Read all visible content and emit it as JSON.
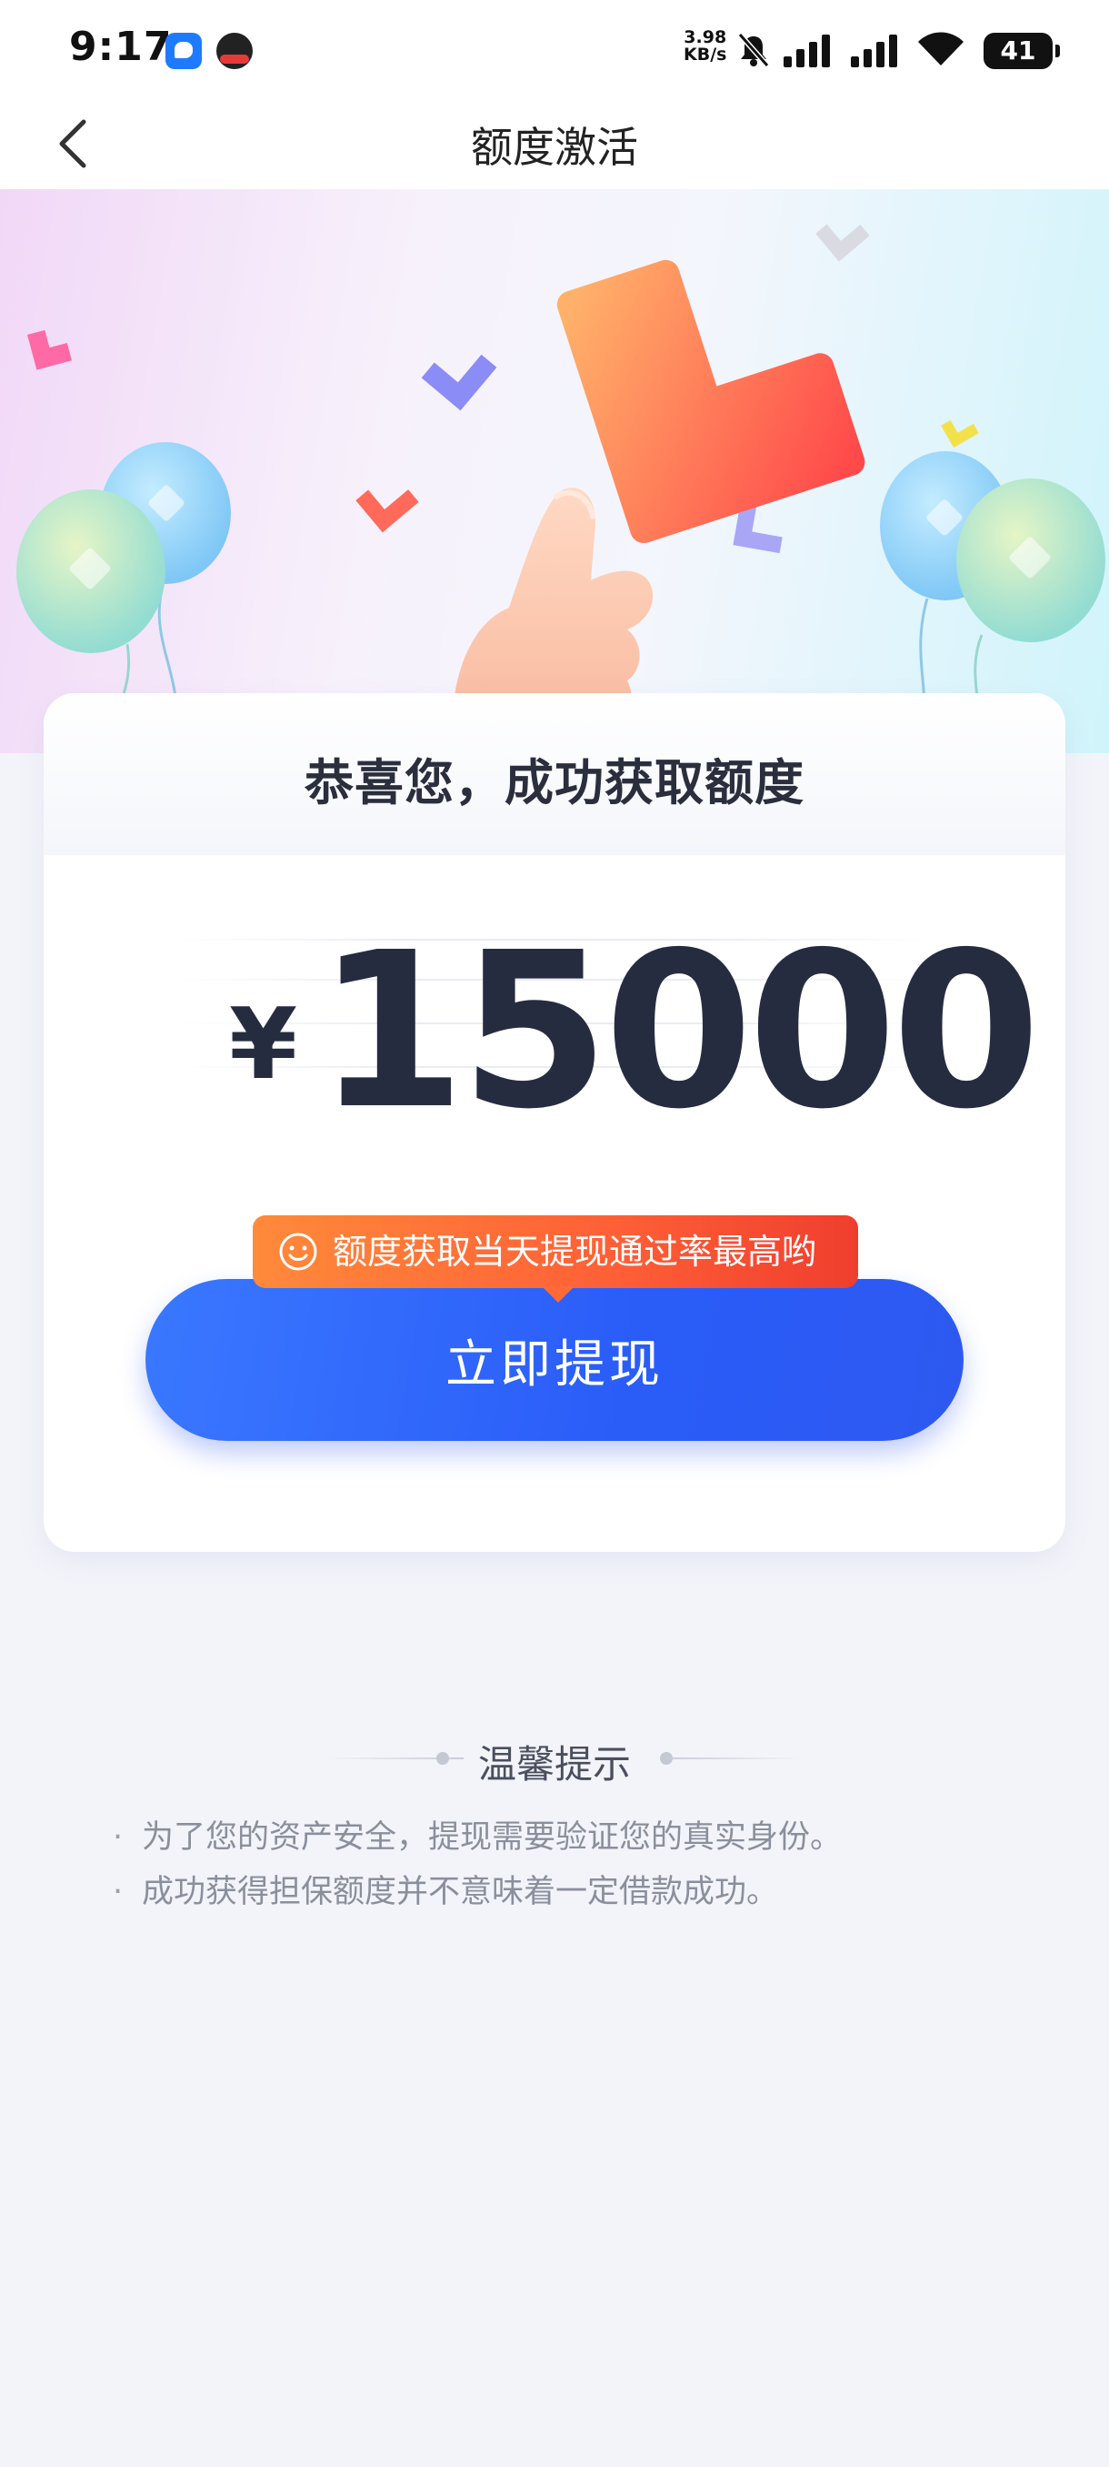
{
  "status_bar": {
    "time": "9:17",
    "net_speed_value": "3.98",
    "net_speed_unit": "KB/s",
    "battery": "41",
    "icons": [
      "chat-app-icon",
      "game-app-icon",
      "mute-icon",
      "signal-icon",
      "signal-icon",
      "wifi-icon",
      "battery-icon"
    ]
  },
  "nav": {
    "title": "额度激活",
    "back_icon": "chevron-left-icon"
  },
  "card": {
    "title": "恭喜您，成功获取额度",
    "currency": "¥",
    "amount": "15000",
    "tooltip": "额度获取当天提现通过率最高哟",
    "tooltip_icon": "smile-icon",
    "button_label": "立即提现"
  },
  "tips": {
    "heading": "温馨提示",
    "items": [
      "为了您的资产安全，提现需要验证您的真实身份。",
      "成功获得担保额度并不意味着一定借款成功。"
    ]
  },
  "colors": {
    "primary_button": "#2a5cf8",
    "tooltip": "#ff5f36",
    "amount_text": "#262c40",
    "page_background": "#f3f4fa"
  }
}
